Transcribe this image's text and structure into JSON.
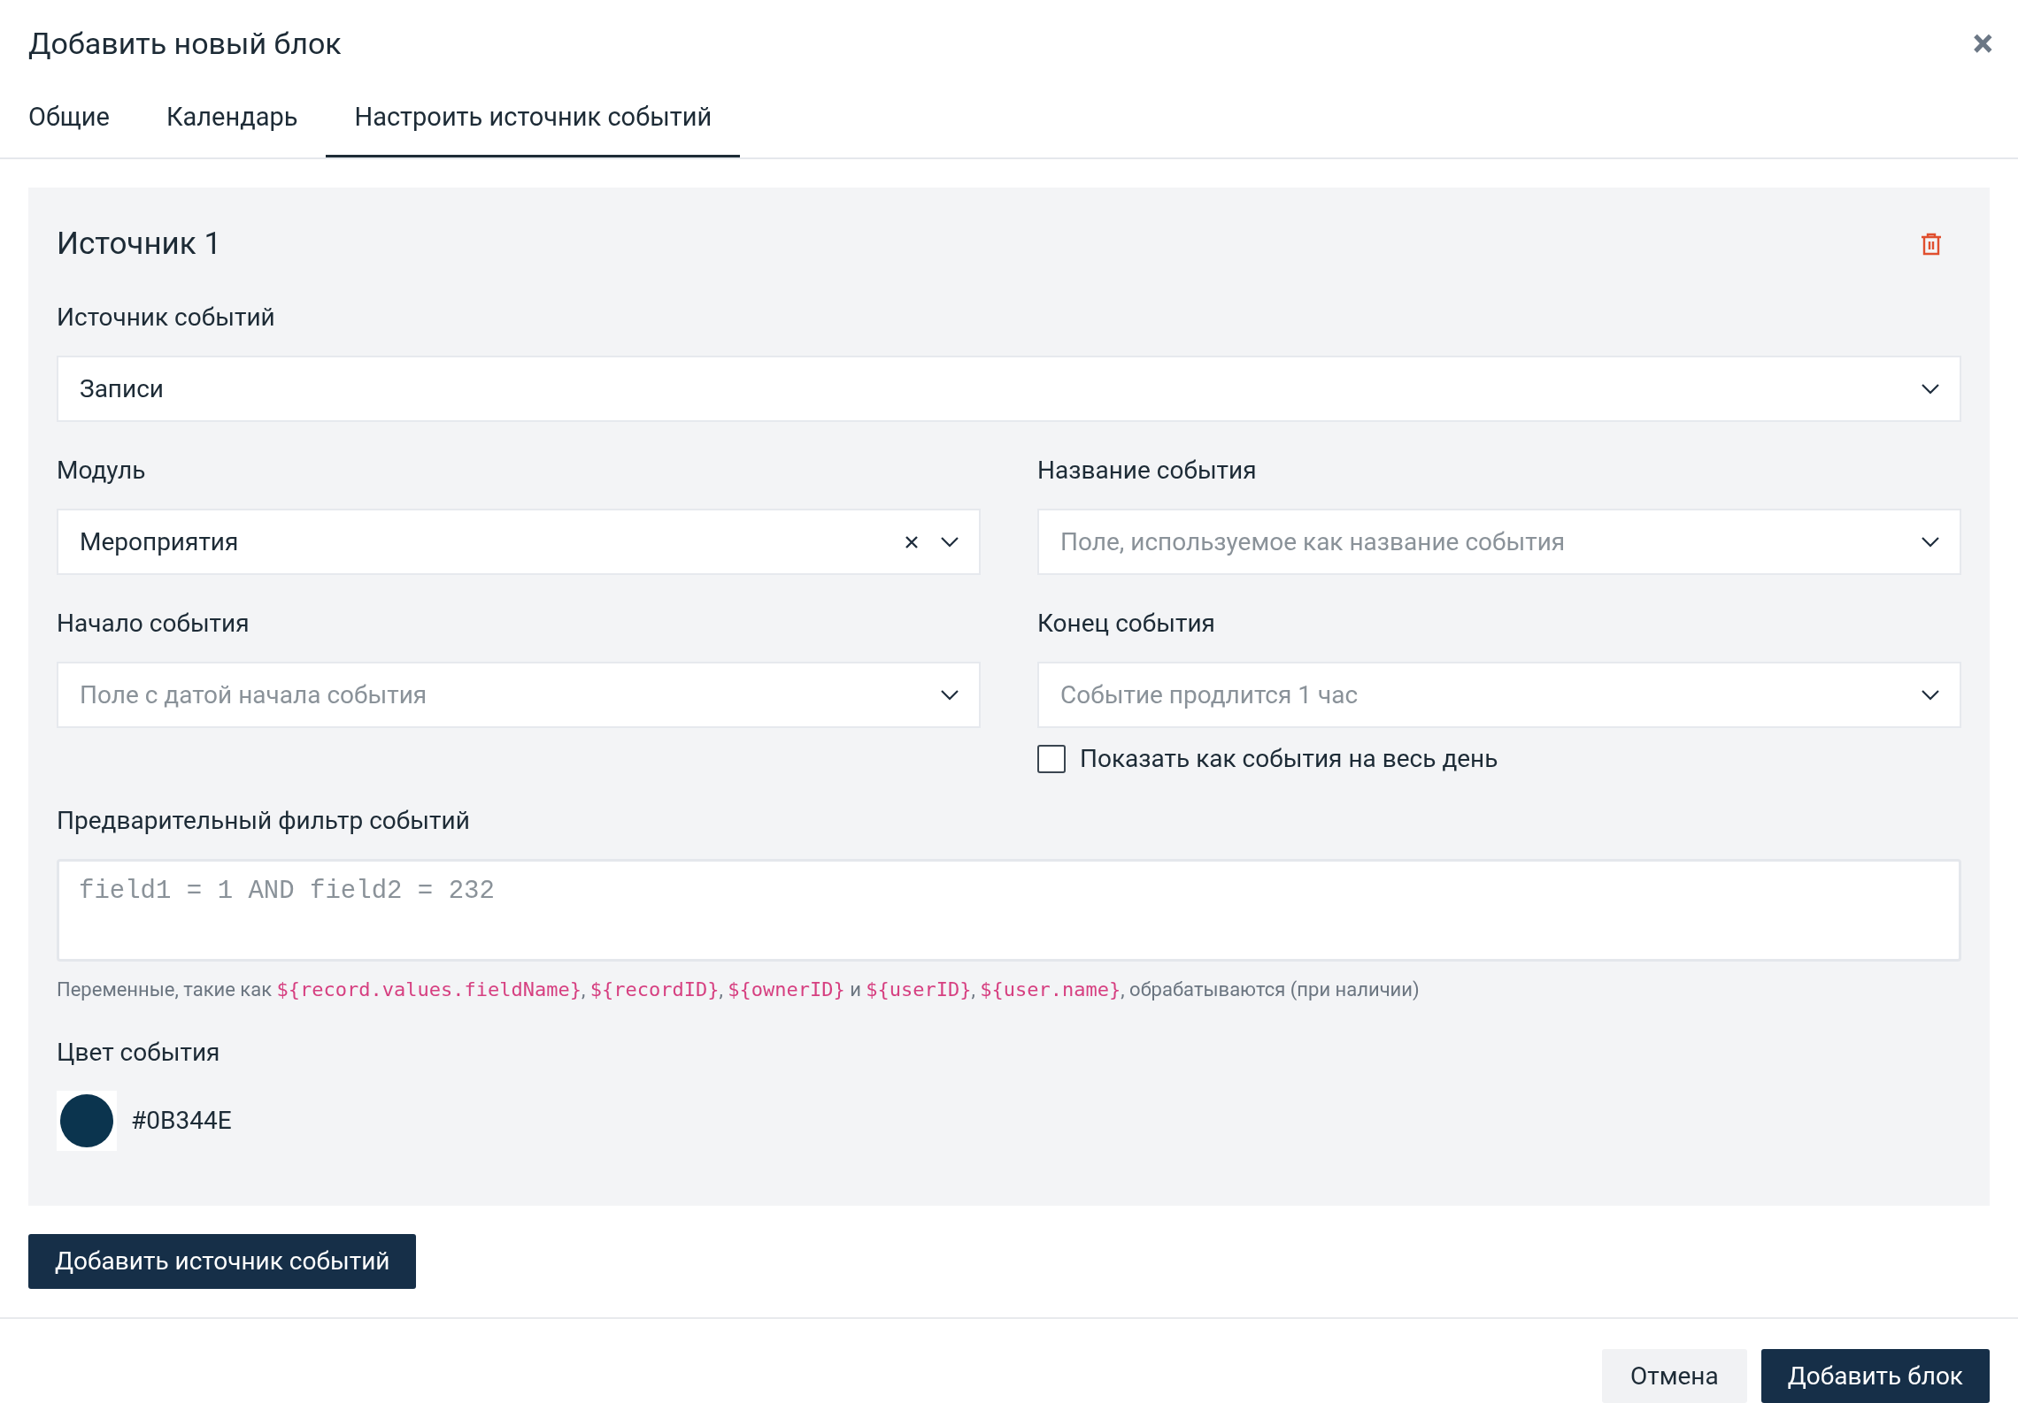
{
  "dialog": {
    "title": "Добавить новый блок",
    "close": "×"
  },
  "tabs": [
    {
      "label": "Общие",
      "selected": false
    },
    {
      "label": "Календарь",
      "selected": false
    },
    {
      "label": "Настроить источник событий",
      "selected": true
    }
  ],
  "source": {
    "title": "Источник 1",
    "event_source": {
      "label": "Источник событий",
      "value": "Записи"
    },
    "fields": [
      {
        "label": "Модуль",
        "value": "Мероприятия",
        "clearable": true
      },
      {
        "label": "Название события",
        "placeholder": "Поле, используемое как название события",
        "clearable": false
      },
      {
        "label": "Начало события",
        "placeholder": "Поле с датой начала события",
        "clearable": false
      },
      {
        "label": "Конец события",
        "placeholder": "Событие продлится 1 час",
        "clearable": false
      }
    ],
    "all_day": {
      "label": "Показать как события на весь день",
      "checked": false
    },
    "filter": {
      "label": "Предварительный фильтр событий",
      "placeholder": "field1 = 1 AND field2 = 232"
    },
    "hint": [
      {
        "kind": "text",
        "text": "Переменные, такие как "
      },
      {
        "kind": "code",
        "text": "${record.values.fieldName}"
      },
      {
        "kind": "text",
        "text": ", "
      },
      {
        "kind": "code",
        "text": "${recordID}"
      },
      {
        "kind": "text",
        "text": ", "
      },
      {
        "kind": "code",
        "text": "${ownerID}"
      },
      {
        "kind": "text",
        "text": " и "
      },
      {
        "kind": "code",
        "text": "${userID}"
      },
      {
        "kind": "text",
        "text": ", "
      },
      {
        "kind": "code",
        "text": "${user.name}"
      },
      {
        "kind": "text",
        "text": ", обрабатываются (при наличии)"
      }
    ],
    "color": {
      "label": "Цвет события",
      "value": "#0B344E",
      "color": "#0b344e"
    }
  },
  "add_source_button": "Добавить источник событий",
  "footer": {
    "cancel": "Отмена",
    "submit": "Добавить блок"
  }
}
